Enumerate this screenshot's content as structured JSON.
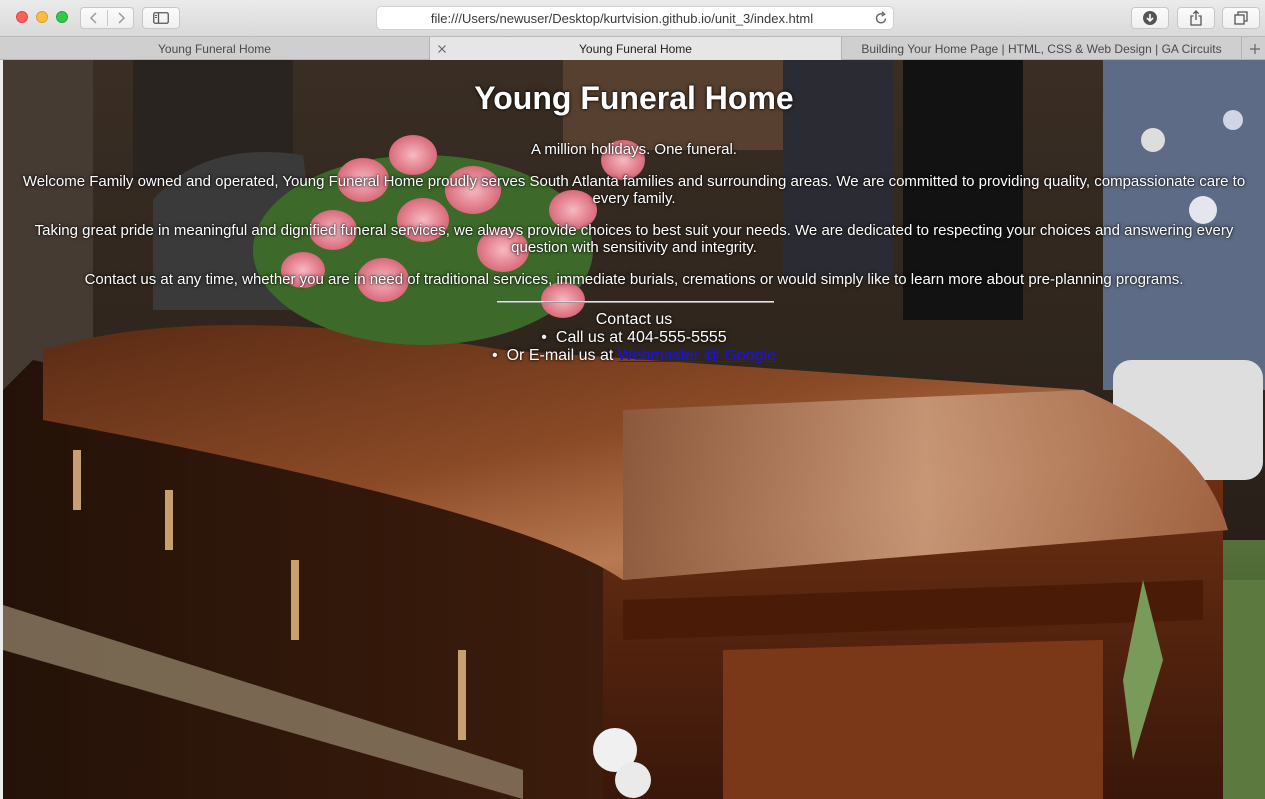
{
  "browser": {
    "url": "file:///Users/newuser/Desktop/kurtvision.github.io/unit_3/index.html",
    "tabs": [
      {
        "label": "Young Funeral Home"
      },
      {
        "label": "Young Funeral Home"
      },
      {
        "label": "Building Your Home Page | HTML, CSS & Web Design | GA Circuits"
      }
    ]
  },
  "page": {
    "title": "Young Funeral Home",
    "tagline": "A million holidays. One funeral.",
    "paragraphs": [
      "Welcome Family owned and operated, Young Funeral Home proudly serves South Atlanta families and surrounding areas. We are committed to providing quality, compassionate care to every family.",
      "Taking great pride in meaningful and dignified funeral services, we always provide choices to best suit your needs. We are dedicated to respecting your choices and answering every question with sensitivity and integrity.",
      "Contact us at any time, whether you are in need of traditional services, immediate burials, cremations or would simply like to learn more about pre-planning programs."
    ],
    "contact": {
      "heading": "Contact us",
      "phone_text": "Call us at 404-555-5555",
      "email_prefix": "Or E-mail us at ",
      "email_link": "Webmaster @ Google"
    }
  },
  "colors": {
    "link": "#1a0dff",
    "text": "#ffffff"
  }
}
